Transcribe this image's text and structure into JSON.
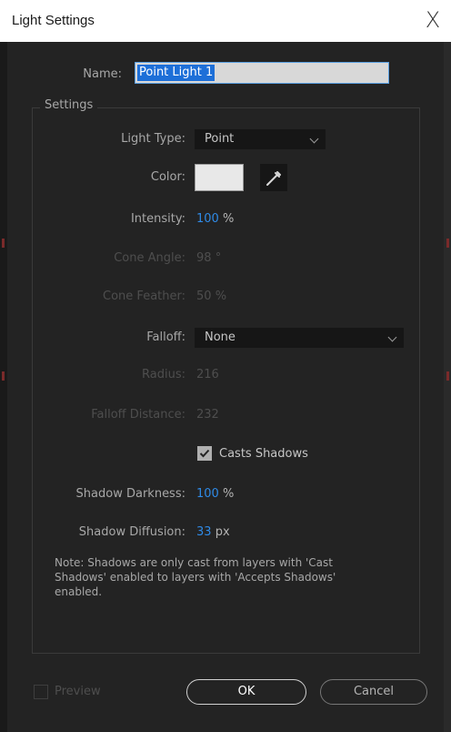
{
  "window": {
    "title": "Light Settings",
    "close_glyph": "X"
  },
  "name_field": {
    "label": "Name:",
    "value": "Point Light 1"
  },
  "settings_group": {
    "legend": "Settings"
  },
  "light_type": {
    "label": "Light Type:",
    "value": "Point"
  },
  "color": {
    "label": "Color:",
    "swatch_hex": "#e8e8e8"
  },
  "intensity": {
    "label": "Intensity:",
    "value": "100",
    "unit": "%"
  },
  "cone_angle": {
    "label": "Cone Angle:",
    "value": "98",
    "unit": "°"
  },
  "cone_feather": {
    "label": "Cone Feather:",
    "value": "50",
    "unit": "%"
  },
  "falloff": {
    "label": "Falloff:",
    "value": "None"
  },
  "radius": {
    "label": "Radius:",
    "value": "216"
  },
  "falloff_distance": {
    "label": "Falloff Distance:",
    "value": "232"
  },
  "casts_shadows": {
    "label": "Casts Shadows",
    "checked": true
  },
  "shadow_darkness": {
    "label": "Shadow Darkness:",
    "value": "100",
    "unit": "%"
  },
  "shadow_diffusion": {
    "label": "Shadow Diffusion:",
    "value": "33",
    "unit": "px"
  },
  "note": "Note: Shadows are only cast from layers with 'Cast Shadows' enabled to layers with 'Accepts Shadows' enabled.",
  "preview": {
    "label": "Preview",
    "checked": false
  },
  "buttons": {
    "ok": "OK",
    "cancel": "Cancel"
  },
  "colors": {
    "accent_blue": "#2f8ae6",
    "selection": "#1d6fd8",
    "background": "#232323"
  }
}
